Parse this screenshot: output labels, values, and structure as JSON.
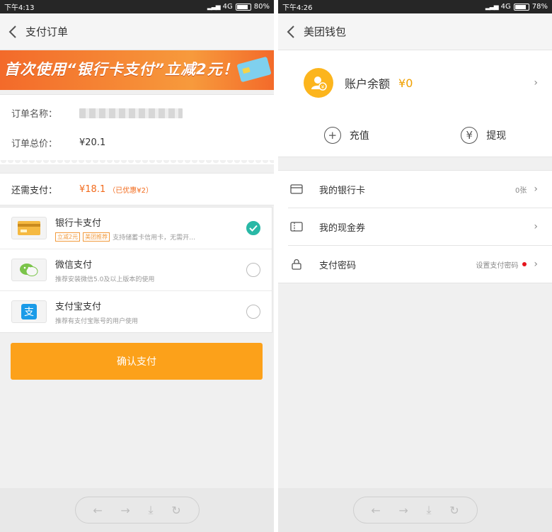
{
  "left": {
    "status": {
      "time": "下午4:13",
      "network": "4G",
      "battery": "80%"
    },
    "nav": {
      "title": "支付订单"
    },
    "banner": {
      "text": "首次使用“银行卡支付”立减2元！"
    },
    "order": {
      "name_label": "订单名称：",
      "total_label": "订单总价：",
      "total_value": "¥20.1"
    },
    "need_pay": {
      "label": "还需支付：",
      "amount": "¥18.1",
      "note": "（已优惠¥2）"
    },
    "methods": [
      {
        "name": "银行卡支付",
        "tags": [
          "立减2元",
          "美团推荐"
        ],
        "desc": "支持储蓄卡信用卡，无需开…",
        "selected": true
      },
      {
        "name": "微信支付",
        "desc": "推荐安装微信5.0及以上版本的使用",
        "selected": false
      },
      {
        "name": "支付宝支付",
        "desc": "推荐有支付宝账号的用户使用",
        "selected": false
      }
    ],
    "confirm_label": "确认支付"
  },
  "right": {
    "status": {
      "time": "下午4:26",
      "network": "4G",
      "battery": "78%"
    },
    "nav": {
      "title": "美团钱包"
    },
    "balance": {
      "label": "账户余额",
      "value": "¥0"
    },
    "actions": [
      {
        "label": "充值"
      },
      {
        "label": "提现"
      }
    ],
    "menu": [
      {
        "label": "我的银行卡",
        "extra": "0张"
      },
      {
        "label": "我的现金券",
        "extra": ""
      },
      {
        "label": "支付密码",
        "extra": "设置支付密码"
      }
    ]
  },
  "colors": {
    "accent": "#fca11a",
    "orange_text": "#f26b1d",
    "check": "#29b8a6",
    "red_dot": "#e5141c"
  }
}
